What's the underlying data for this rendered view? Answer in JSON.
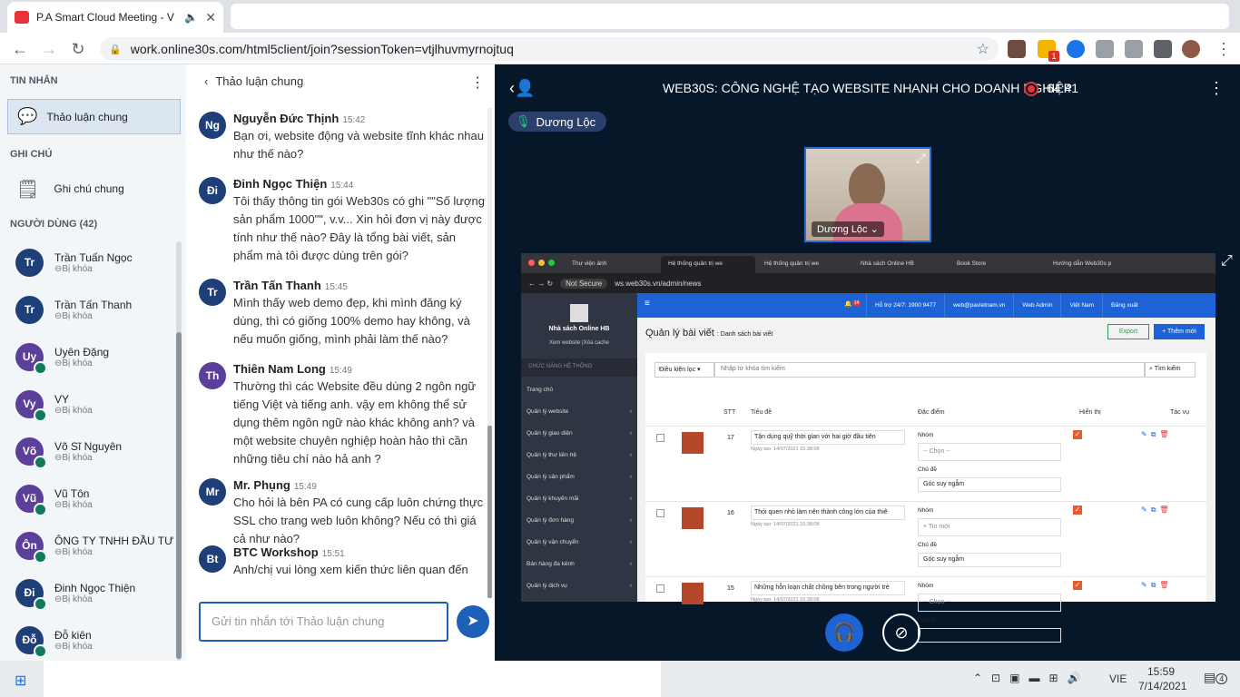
{
  "browser": {
    "tab_title": "P.A Smart Cloud Meeting - V",
    "url": "work.online30s.com/html5client/join?sessionToken=vtjlhuvmyrnojtuq",
    "ext_badge": "1"
  },
  "sidebar": {
    "messages_title": "TIN NHẮN",
    "public_chat": "Thảo luận chung",
    "notes_title": "GHI CHÚ",
    "shared_notes": "Ghi chú chung",
    "users_title": "NGƯỜI DÙNG (42)",
    "users": [
      {
        "initials": "Tr",
        "name": "Trần Tuấn Ngọc",
        "status": "Bị khóa",
        "mic": false
      },
      {
        "initials": "Tr",
        "name": "Trần Tấn Thanh",
        "status": "Bị khóa",
        "mic": false
      },
      {
        "initials": "Uy",
        "name": "Uyên Đặng",
        "status": "Bị khóa",
        "mic": true
      },
      {
        "initials": "Vy",
        "name": "VY",
        "status": "Bị khóa",
        "mic": true
      },
      {
        "initials": "Võ",
        "name": "Võ Sĩ Nguyên",
        "status": "Bị khóa",
        "mic": true
      },
      {
        "initials": "Vũ",
        "name": "Vũ Tôn",
        "status": "Bị khóa",
        "mic": true
      },
      {
        "initials": "Ôn",
        "name": "ÔNG TY TNHH ĐẦU TƯ ...",
        "status": "Bị khóa",
        "mic": true
      },
      {
        "initials": "Đi",
        "name": "Đinh Ngọc Thiện",
        "status": "Bị khóa",
        "mic": true
      },
      {
        "initials": "Đỗ",
        "name": "Đỗ kiên",
        "status": "Bị khóa",
        "mic": true
      }
    ]
  },
  "chat": {
    "header": "Thảo luận chung",
    "messages": [
      {
        "initials": "Ng",
        "name": "Nguyễn Đức Thịnh",
        "time": "15:42",
        "text": "Bạn ơi, website động và website tĩnh khác nhau như thế nào?"
      },
      {
        "initials": "Đi",
        "name": "Đinh Ngọc Thiện",
        "time": "15:44",
        "text": "Tôi thấy thông tin gói Web30s có ghi \"\"Số lượng sản phẩm 1000\"\", v.v... Xin hỏi đơn vị này được tính như thế nào? Đây là tổng bài viết, sản phẩm mà tôi được dùng trên gói?"
      },
      {
        "initials": "Tr",
        "name": "Trần Tấn Thanh",
        "time": "15:45",
        "text": "Mình thấy web demo đẹp, khi mình đăng ký dùng, thì có giống 100% demo hay không, và nếu muốn giống, mình phải làm thế nào?"
      },
      {
        "initials": "Th",
        "name": "Thiên Nam Long",
        "time": "15:49",
        "text": "Thường thì các Website đều dùng 2 ngôn ngữ tiếng Việt và tiếng anh. vậy em không thể sử dụng thêm ngôn ngữ nào khác không anh? và một website chuyên nghiệp hoàn hảo thì cần những tiêu chí nào hả anh ?"
      },
      {
        "initials": "Mr",
        "name": "Mr. Phụng",
        "time": "15:49",
        "text": "Cho hỏi là bên PA có cung cấp luôn chứng thực SSL cho trang web luôn không? Nếu có thì giá cả như nào?"
      },
      {
        "initials": "Bt",
        "name": "BTC Workshop",
        "time": "15:51",
        "text": "Anh/chị vui lòng xem kiến thức liên quan đến"
      }
    ],
    "input_placeholder": "Gửi tin nhắn tới Thảo luận chung"
  },
  "presentation": {
    "title": "WEB30S: CÔNG NGHỆ TẠO WEBSITE NHANH CHO DOANH NGHIỆP",
    "timer": "64:41",
    "speaker": "Dương Lộc",
    "webcam_name": "Dương Lộc",
    "shared": {
      "tabs": [
        "Thư viện ảnh",
        "Hệ thống quản trị we",
        "Hệ thống quản trị we",
        "Nhà sách Online HB",
        "Book Store",
        "Hướng dẫn Web30s p"
      ],
      "url_secure": "Not Secure",
      "url": "ws.web30s.vn/admin/news",
      "site_name": "Nhà sách Online HB",
      "site_links": "Xem website |Xóa cache",
      "menu_header": "CHỨC NĂNG HỆ THỐNG",
      "menu": [
        "Trang chủ",
        "Quản lý website",
        "Quản lý giao diện",
        "Quản lý thư liên hệ",
        "Quản lý sản phẩm",
        "Quản lý khuyến mãi",
        "Quản lý đơn hàng",
        "Quản lý vận chuyển",
        "Bán hàng đa kênh",
        "Quản lý dịch vụ"
      ],
      "top_links": [
        "Hỗ trợ 24/7: 1900 9477",
        "web@pavietnam.vn",
        "Web Admin",
        "Việt Nam",
        "Đăng xuất"
      ],
      "notif_badge": "14",
      "page_title": "Quản lý bài viết",
      "page_sub": "Danh sách bài viết",
      "btn_export": "Export",
      "btn_add": "+ Thêm mới",
      "filter": "Điều kiện lọc",
      "search_placeholder": "Nhập từ khóa tìm kiếm",
      "search_btn": "Tìm kiếm",
      "columns": [
        "STT",
        "Tiêu đề",
        "Đặc điểm",
        "Hiển thị",
        "Tác vụ"
      ],
      "group_label": "Nhóm",
      "topic_label": "Chủ đề",
      "choose": "-- Chọn --",
      "rows": [
        {
          "stt": "17",
          "title": "Tận dụng quỹ thời gian với hai giờ đầu tiên",
          "date": "Ngày tạo: 14/07/2021 15:38:08",
          "group": "-- Chọn --",
          "topic": "Góc suy ngẫm"
        },
        {
          "stt": "16",
          "title": "Thói quen nhỏ làm nên thành công lớn của thiê",
          "date": "Ngày tạo: 14/07/2021 15:38:08",
          "group": "× Tin mới",
          "topic": "Góc suy ngẫm"
        },
        {
          "stt": "15",
          "title": "Những hỗn loạn chất chồng bên trong người trẻ",
          "date": "Ngày tạo: 14/07/2021 15:38:08",
          "group": "-- Chọn --",
          "topic": ""
        }
      ]
    }
  },
  "taskbar": {
    "lang": "VIE",
    "time": "15:59",
    "date": "7/14/2021",
    "notif": "4"
  }
}
